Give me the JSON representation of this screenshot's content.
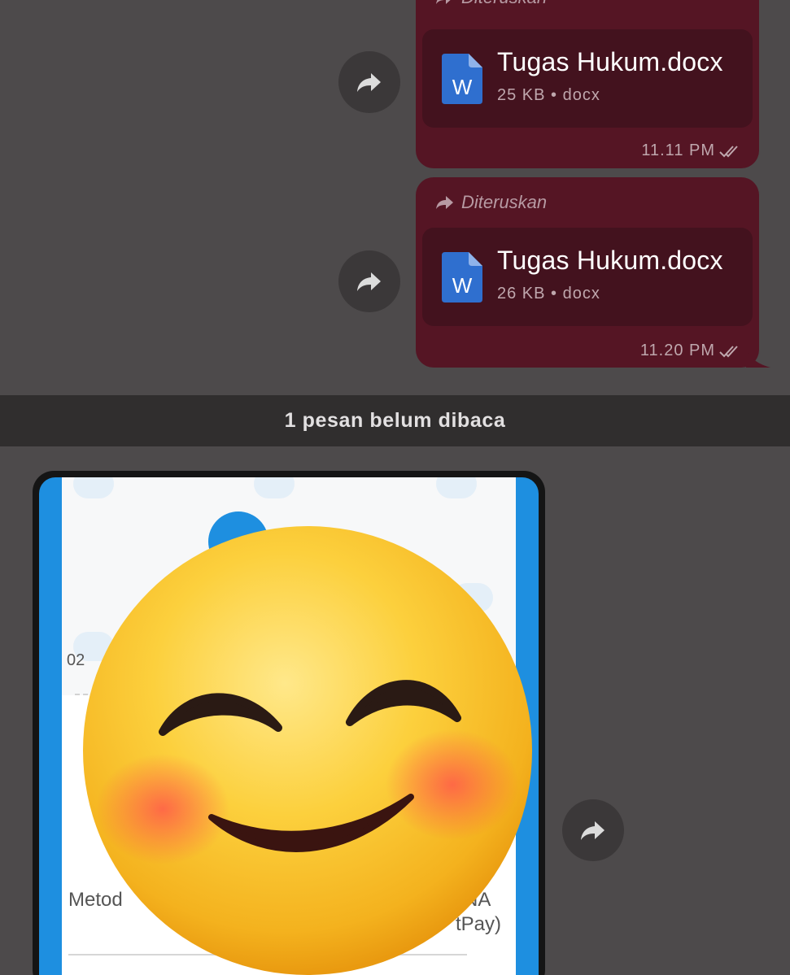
{
  "messages": [
    {
      "forwarded_label": "Diteruskan",
      "file_name": "Tugas Hukum.docx",
      "file_size": "25 KB",
      "file_type": "docx",
      "time": "11.11 PM"
    },
    {
      "forwarded_label": "Diteruskan",
      "file_name": "Tugas Hukum.docx",
      "file_size": "26 KB",
      "file_type": "docx",
      "time": "11.20 PM"
    }
  ],
  "unread_divider": "1 pesan belum dibaca",
  "image_message": {
    "partial_text_left_top": "02",
    "partial_text_method": "Metod",
    "partial_text_right_1": "NA",
    "partial_text_right_2": "tPay)"
  },
  "doc_icon_letter": "W",
  "icons": [
    "forward-icon",
    "word-document-icon",
    "double-check-icon",
    "smiling-face-emoji"
  ],
  "colors": {
    "background": "#4d4a4b",
    "outgoing_bubble": "#551524",
    "file_card": "#43121e",
    "unread_bar": "#302e2e",
    "word_blue": "#2f6fcf"
  },
  "meta_separator": "•"
}
